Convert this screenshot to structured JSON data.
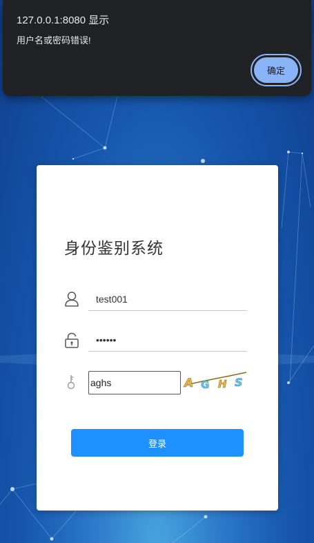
{
  "dialog": {
    "title": "127.0.0.1:8080 显示",
    "message": "用户名或密码错误!",
    "ok_label": "确定"
  },
  "login": {
    "title": "身份鉴别系统",
    "username_value": "test001",
    "password_value": "••••••",
    "captcha_value": "aghs",
    "captcha_image_text": "AGHS",
    "submit_label": "登录"
  },
  "colors": {
    "primary_button": "#1e90ff",
    "dialog_background": "#202124",
    "dialog_button": "#8ab4f8",
    "background_blue": "#1656ad"
  },
  "icons": {
    "username": "user-icon",
    "password": "lock-icon",
    "captcha": "key-icon"
  }
}
